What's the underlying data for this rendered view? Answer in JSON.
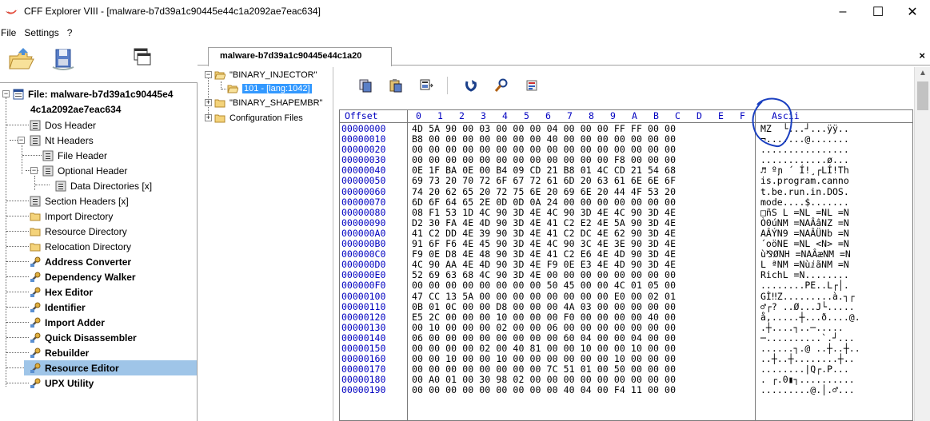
{
  "window": {
    "title": "CFF Explorer VIII - [malware-b7d39a1c90445e44c1a2092ae7eac634]",
    "minimize": "–",
    "maximize": "☐",
    "close": "✕"
  },
  "menu": [
    "File",
    "Settings",
    "?"
  ],
  "left_tree": {
    "file_label_line1": "File: malware-b7d39a1c90445e4",
    "file_label_line2": "4c1a2092ae7eac634",
    "items": [
      {
        "label": "Dos Header"
      },
      {
        "label": "Nt Headers"
      },
      {
        "label": "File Header"
      },
      {
        "label": "Optional Header"
      },
      {
        "label": "Data Directories [x]"
      },
      {
        "label": "Section Headers [x]"
      },
      {
        "label": "Import Directory"
      },
      {
        "label": "Resource Directory"
      },
      {
        "label": "Relocation Directory"
      },
      {
        "label": "Address Converter"
      },
      {
        "label": "Dependency Walker"
      },
      {
        "label": "Hex Editor"
      },
      {
        "label": "Identifier"
      },
      {
        "label": "Import Adder"
      },
      {
        "label": "Quick Disassembler"
      },
      {
        "label": "Rebuilder"
      },
      {
        "label": "Resource Editor"
      },
      {
        "label": "UPX Utility"
      }
    ]
  },
  "tab": {
    "label": "malware-b7d39a1c90445e44c1a20",
    "close": "×"
  },
  "resource_tree": {
    "items": [
      {
        "label": "\"BINARY_INJECTOR\""
      },
      {
        "label": "101 - [lang:1042]"
      },
      {
        "label": "\"BINARY_SHAPEMBR\""
      },
      {
        "label": "Configuration Files"
      }
    ]
  },
  "hex": {
    "header_offset": "Offset",
    "header_ascii": "Ascii",
    "header_cols": [
      "0",
      "1",
      "2",
      "3",
      "4",
      "5",
      "6",
      "7",
      "8",
      "9",
      "A",
      "B",
      "C",
      "D",
      "E",
      "F"
    ],
    "offsets": "00000000\n00000010\n00000020\n00000030\n00000040\n00000050\n00000060\n00000070\n00000080\n00000090\n000000A0\n000000B0\n000000C0\n000000D0\n000000E0\n000000F0\n00000100\n00000110\n00000120\n00000130\n00000140\n00000150\n00000160\n00000170\n00000180\n00000190",
    "bytes": "4D 5A 90 00 03 00 00 00 04 00 00 00 FF FF 00 00\nB8 00 00 00 00 00 00 00 40 00 00 00 00 00 00 00\n00 00 00 00 00 00 00 00 00 00 00 00 00 00 00 00\n00 00 00 00 00 00 00 00 00 00 00 00 F8 00 00 00\n0E 1F BA 0E 00 B4 09 CD 21 B8 01 4C CD 21 54 68\n69 73 20 70 72 6F 67 72 61 6D 20 63 61 6E 6E 6F\n74 20 62 65 20 72 75 6E 20 69 6E 20 44 4F 53 20\n6D 6F 64 65 2E 0D 0D 0A 24 00 00 00 00 00 00 00\n08 F1 53 1D 4C 90 3D 4E 4C 90 3D 4E 4C 90 3D 4E\nD2 30 FA 4E 4D 90 3D 4E 41 C2 E2 4E 5A 90 3D 4E\n41 C2 DD 4E 39 90 3D 4E 41 C2 DC 4E 62 90 3D 4E\n91 6F F6 4E 45 90 3D 4E 4C 90 3C 4E 3E 90 3D 4E\nF9 0E D8 4E 48 90 3D 4E 41 C2 E6 4E 4D 90 3D 4E\n4C 90 AA 4E 4D 90 3D 4E F9 0E E3 4E 4D 90 3D 4E\n52 69 63 68 4C 90 3D 4E 00 00 00 00 00 00 00 00\n00 00 00 00 00 00 00 00 50 45 00 00 4C 01 05 00\n47 CC 13 5A 00 00 00 00 00 00 00 00 E0 00 02 01\n0B 01 0C 00 00 D8 00 00 00 4A 03 00 00 00 00 00\nE5 2C 00 00 00 10 00 00 00 F0 00 00 00 00 40 00\n00 10 00 00 00 02 00 00 06 00 00 00 00 00 00 00\n06 00 00 00 00 00 00 00 00 60 04 00 00 04 00 00\n00 00 00 00 02 00 40 81 00 00 10 00 00 10 00 00\n00 00 10 00 00 10 00 00 00 00 00 00 10 00 00 00\n00 00 00 00 00 00 00 00 7C 51 01 00 50 00 00 00\n00 A0 01 00 30 98 02 00 00 00 00 00 00 00 00 00\n00 00 00 00 00 00 00 00 00 40 04 00 F4 11 00 00",
    "ascii": "MZ  └...┘...ÿÿ..\n¬.......@.......\n................\n............ø...\n♬ ºɲ ´ Í!¸┌LÍ!Th\nis.program.canno\nt.be.run.in.DOS.\nmode....$.......\n□ñS L =NL =NL =N\nÒ0úNM =NAÂâNZ =N\nAÂÝN9 =NAÂÜNb =N\n´oöNE =NL <N> =N\nù⅋ØNH =NAÂæNM =N\nL ªNM =NùⅈãNM =N\nRichL =N........\n........PE..L┌│.\nGÌ‼Z.........à.┐┌\n♂┌? ..Ø...J└.....\nå,.....┼...ð....@.\n.┼....┐..─.....\n─..........`.┘...\n......┐.@ ..┼..┼..\n..┼..┼........┼..\n........|Q┌.P...\n. ┌.0▮┐..........\n.........@.│.♂..."
  }
}
